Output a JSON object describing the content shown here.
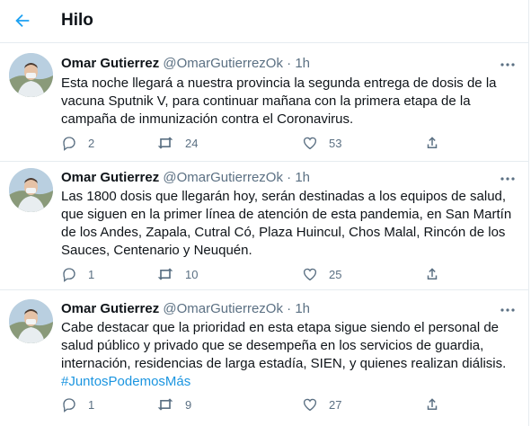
{
  "header": {
    "title": "Hilo"
  },
  "tweets": [
    {
      "name": "Omar Gutierrez",
      "handle": "@OmarGutierrezOk",
      "dot": "·",
      "time": "1h",
      "lines": [
        "Esta noche llegará a nuestra provincia la segunda entrega de dosis de la",
        "vacuna Sputnik V, para continuar mañana con la primera etapa de la",
        "campaña de inmunización contra el Coronavirus."
      ],
      "hashtag": "",
      "replies": "2",
      "retweets": "24",
      "likes": "53"
    },
    {
      "name": "Omar Gutierrez",
      "handle": "@OmarGutierrezOk",
      "dot": "·",
      "time": "1h",
      "lines": [
        "Las 1800 dosis que llegarán hoy, serán destinadas a los equipos de salud,",
        "que siguen en la primer línea de atención de esta pandemia, en San Martín",
        "de los Andes, Zapala, Cutral Có, Plaza Huincul, Chos Malal, Rincón de los",
        "Sauces, Centenario y Neuquén."
      ],
      "hashtag": "",
      "replies": "1",
      "retweets": "10",
      "likes": "25"
    },
    {
      "name": "Omar Gutierrez",
      "handle": "@OmarGutierrezOk",
      "dot": "·",
      "time": "1h",
      "lines": [
        "Cabe destacar que la prioridad en esta etapa sigue siendo el personal de",
        "salud público y privado que se desempeña en los servicios de guardia,",
        "internación, residencias de larga estadía, SIEN, y quienes realizan diálisis."
      ],
      "hashtag": "#JuntosPodemosMás",
      "replies": "1",
      "retweets": "9",
      "likes": "27"
    }
  ],
  "colors": {
    "accent": "#1da1f2",
    "secondary_text": "#5b7083",
    "hashtag": "#1b95e0",
    "border": "#e6ecf0"
  },
  "icons": {
    "back": "arrow-left-icon",
    "more": "more-horizontal-icon",
    "reply": "reply-icon",
    "retweet": "retweet-icon",
    "like": "heart-icon",
    "share": "share-icon"
  }
}
